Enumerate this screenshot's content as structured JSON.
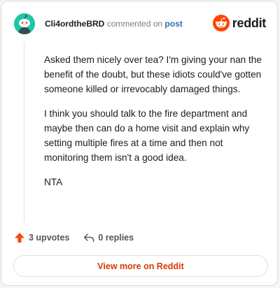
{
  "header": {
    "username": "Cli4ordtheBRD",
    "commented_on": "commented on",
    "post_link": "post"
  },
  "brand": {
    "name": "reddit",
    "color": "#ff4500"
  },
  "comment": {
    "paragraphs": [
      "Asked them nicely over tea? I'm giving your nan the benefit of the doubt, but these idiots could've gotten someone killed or irrevocably damaged things.",
      "I think you should talk to the fire department and maybe then can do a home visit and explain why setting multiple fires at a time and then not monitoring them isn't a good idea.",
      "NTA"
    ]
  },
  "actions": {
    "upvotes": "3 upvotes",
    "replies": "0 replies"
  },
  "footer": {
    "view_more": "View more on Reddit"
  },
  "colors": {
    "accent": "#d93a00",
    "avatar_bg": "#1fc7a6",
    "upvote": "#ff4500"
  },
  "icons": {
    "avatar": "snoo-avatar-icon",
    "brand": "reddit-logo-icon",
    "upvote": "upvote-arrow-icon",
    "reply": "reply-arrow-icon"
  }
}
